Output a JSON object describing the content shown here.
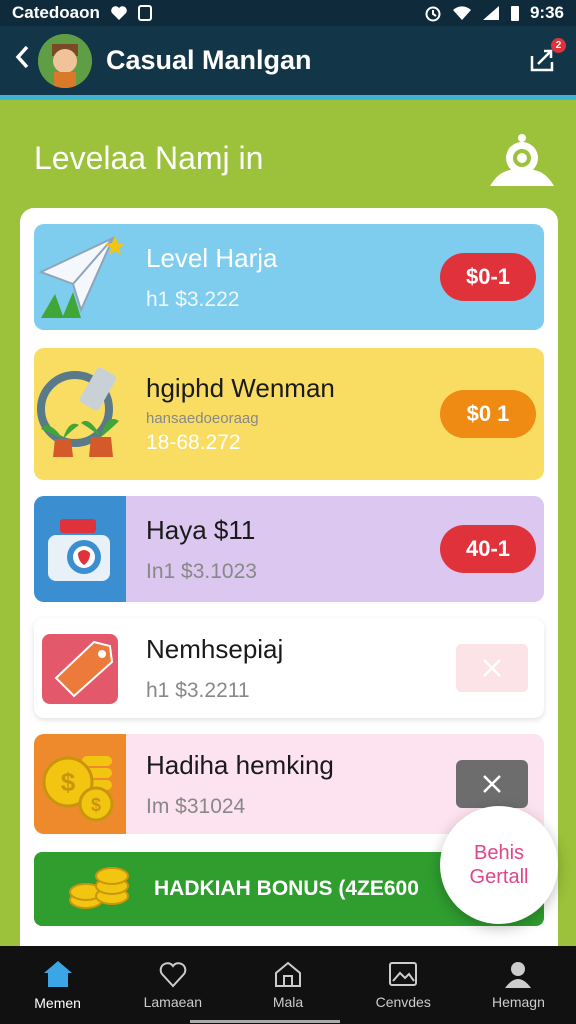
{
  "status_bar": {
    "carrier": "Catedoaon",
    "time": "9:36"
  },
  "app_bar": {
    "title": "Casual Manlgan",
    "notification_count": "2"
  },
  "section": {
    "title": "Levelaa Namj in"
  },
  "items": [
    {
      "title": "Level Harja",
      "sub": "h1 $3.222",
      "action": "$0-1",
      "bg": "#7fcdee",
      "pill_color": "#e0323a"
    },
    {
      "title": "hgiphd Wenman",
      "sub_small": "hansaedoeoraag",
      "sub": "18-68.272",
      "action": "$0 1",
      "bg": "#f9dd63",
      "pill_color": "#ef8a12"
    },
    {
      "title": "Haya $11",
      "sub": "In1 $3.1023",
      "action": "40-1",
      "bg": "#dcc7f0",
      "pill_color": "#e0323a"
    },
    {
      "title": "Nemhsepiaj",
      "sub": "h1 $3.2211",
      "bg": "#ffffff"
    },
    {
      "title": "Hadiha hemking",
      "sub": "Im $31024",
      "bg": "#fde3ef"
    }
  ],
  "bonus": {
    "label": "HADKIAH BONUS (4ZE600"
  },
  "fab": {
    "line1": "Behis",
    "line2": "Gertall"
  },
  "nav": [
    {
      "label": "Memen"
    },
    {
      "label": "Lamaean"
    },
    {
      "label": "Mala"
    },
    {
      "label": "Cenvdes"
    },
    {
      "label": "Hemagn"
    }
  ]
}
